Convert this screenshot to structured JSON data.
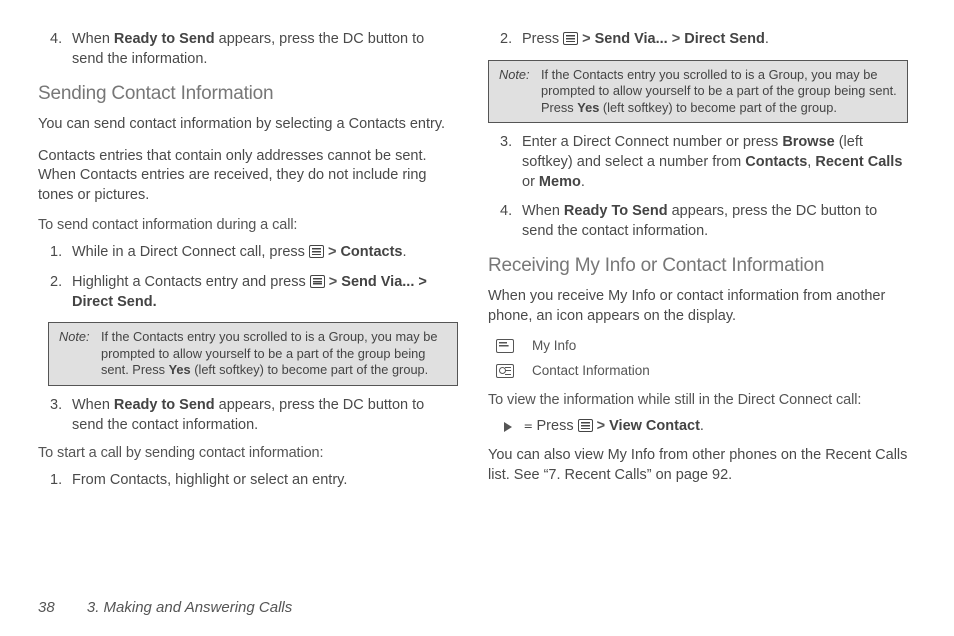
{
  "footer": {
    "page": "38",
    "chapter": "3. Making and Answering Calls"
  },
  "col1": {
    "step4_top": {
      "num": "4.",
      "pre": "When ",
      "bold": "Ready to Send",
      "post": " appears, press the DC button to send the information."
    },
    "h_sending": "Sending Contact Information",
    "p1": "You can send contact information by selecting a Contacts entry.",
    "p2": "Contacts entries that contain only addresses cannot be sent. When Contacts entries are received, they do not include ring tones or pictures.",
    "sub1": "To send contact information during a call:",
    "s1": {
      "num": "1.",
      "pre": "While in a Direct Connect call, press ",
      "gt": ">",
      "bold": "Contacts",
      "dot": "."
    },
    "s2": {
      "num": "2.",
      "pre": "Highlight a Contacts entry and press ",
      "gt": ">",
      "bold": "Send Via... > Direct Send."
    },
    "note": {
      "label": "Note:",
      "text_pre": "If the Contacts entry you scrolled to is a Group, you may be prompted to allow yourself to be a part of the group being sent. Press ",
      "yes": "Yes",
      "text_post": " (left softkey) to become part of the group."
    },
    "s3": {
      "num": "3.",
      "pre": "When ",
      "bold": "Ready to Send",
      "post": " appears, press the DC button to send the contact information."
    },
    "sub2": "To start a call by sending contact information:",
    "b1": {
      "num": "1.",
      "text": "From Contacts, highlight or select an entry."
    }
  },
  "col2": {
    "s2": {
      "num": "2.",
      "pre": "Press ",
      "gt": ">",
      "b1": "Send Via...",
      "gt2": ">",
      "b2": "Direct Send",
      "dot": "."
    },
    "note": {
      "label": "Note:",
      "text_pre": "If the Contacts entry you scrolled to is a Group, you may be prompted to allow yourself to be a part of the group being sent. Press ",
      "yes": "Yes",
      "text_post": " (left softkey) to become part of the group."
    },
    "s3": {
      "num": "3.",
      "pre": "Enter a Direct Connect number or press ",
      "b1": "Browse",
      "mid": " (left softkey) and select a number from ",
      "b2": "Contacts",
      "c1": ", ",
      "b3": "Recent Calls",
      "c2": " or ",
      "b4": "Memo",
      "dot": "."
    },
    "s4": {
      "num": "4.",
      "pre": "When ",
      "bold": "Ready To Send",
      "post": " appears, press the DC button to send the contact information."
    },
    "h_recv": "Receiving My Info or Contact Information",
    "p_recv": "When you receive My Info or contact information from another phone, an icon appears on the display.",
    "icon1": "My Info",
    "icon2": "Contact Information",
    "sub_view": "To view the information while still in the Direct Connect call:",
    "arrow": {
      "pre": "Press ",
      "gt": ">",
      "bold": "View Contact",
      "dot": "."
    },
    "p_last": "You can also view My Info from other phones on the Recent Calls list. See “7. Recent Calls” on page 92."
  }
}
